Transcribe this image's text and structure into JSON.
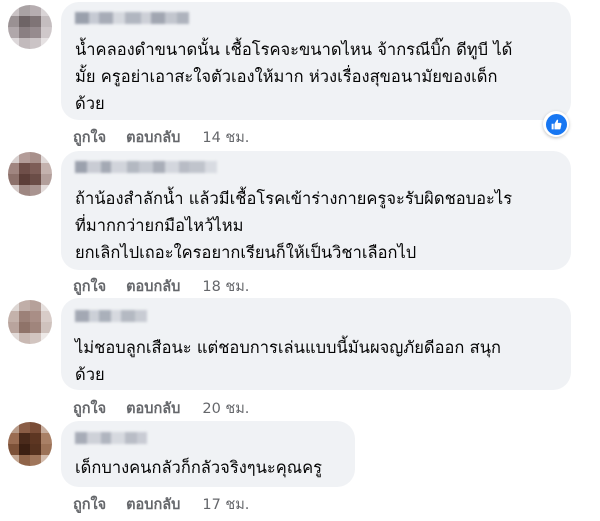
{
  "comments": [
    {
      "text": "น้ำคลองดำขนาดนั้น เชื้อโรคจะขนาดไหน จ้ากรณีบิ๊ก ดีทูบี ได้\nมั้ย ครูอย่าเอาสะใจตัวเองให้มาก ห่วงเรื่องสุขอนามัยของเด็ก\nด้วย",
      "like": "ถูกใจ",
      "reply": "ตอบกลับ",
      "time": "14 ชม.",
      "reaction_icon": "like-icon"
    },
    {
      "text": "ถ้าน้องสำลักน้ำ แล้วมีเชื้อโรคเข้าร่างกายครูจะรับผิดชอบอะไร\nที่มากกว่ายกมือไหว้ไหม\nยกเลิกไปเถอะใครอยากเรียนก็ให้เป็นวิชาเลือกไป",
      "like": "ถูกใจ",
      "reply": "ตอบกลับ",
      "time": "18 ชม."
    },
    {
      "text": "ไม่ชอบลูกเสือนะ แต่ชอบการเล่นแบบนี้มันผจญภัยดีออก สนุก\nด้วย",
      "like": "ถูกใจ",
      "reply": "ตอบกลับ",
      "time": "20 ชม."
    },
    {
      "text": "เด็กบางคนกลัวก็กลัวจริงๆนะคุณครู",
      "like": "ถูกใจ",
      "reply": "ตอบกลับ",
      "time": "17 ชม."
    }
  ],
  "colors": {
    "bubble": "#f0f2f5",
    "text": "#050505",
    "meta": "#65676b",
    "like_blue": "#1877f2"
  }
}
